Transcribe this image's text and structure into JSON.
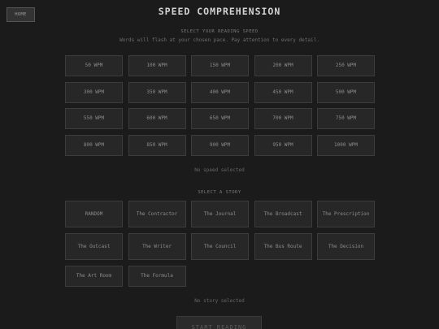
{
  "header": {
    "home_label": "HOME",
    "title": "SPEED COMPREHENSION"
  },
  "speed_section": {
    "label": "SELECT YOUR READING SPEED",
    "hint": "Words will flash at your chosen pace. Pay attention to every detail.",
    "options": [
      "50 WPM",
      "100 WPM",
      "150 WPM",
      "200 WPM",
      "250 WPM",
      "300 WPM",
      "350 WPM",
      "400 WPM",
      "450 WPM",
      "500 WPM",
      "550 WPM",
      "600 WPM",
      "650 WPM",
      "700 WPM",
      "750 WPM",
      "800 WPM",
      "850 WPM",
      "900 WPM",
      "950 WPM",
      "1000 WPM"
    ],
    "status": "No speed selected"
  },
  "story_section": {
    "label": "SELECT A STORY",
    "options": [
      "RANDOM",
      "The Contractor",
      "The Journal",
      "The Broadcast",
      "The Prescription",
      "The Outcast",
      "The Writer",
      "The Council",
      "The Bus Route",
      "The Decision",
      "The Art Room",
      "The Formula"
    ],
    "status": "No story selected"
  },
  "start_label": "START READING"
}
